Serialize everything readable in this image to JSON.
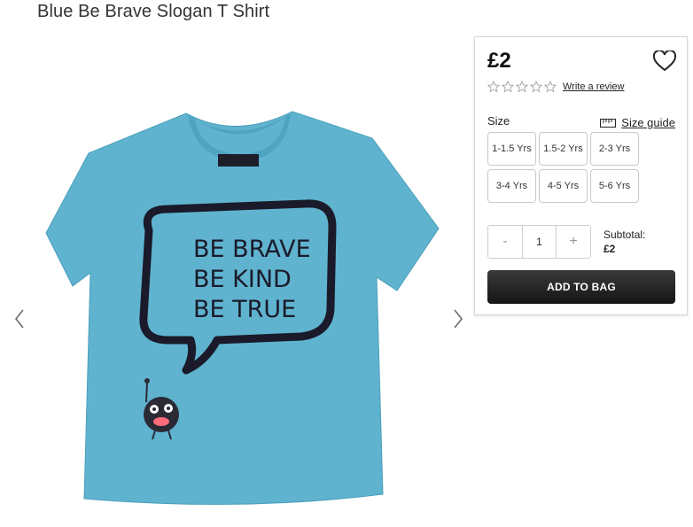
{
  "product": {
    "title": "Blue Be Brave Slogan T Shirt",
    "image_alt": "Blue t-shirt with speech bubble reading BE BRAVE BE KIND BE TRUE",
    "shirt_print": [
      "BE BRAVE",
      "BE KIND",
      "BE TRUE"
    ],
    "colors": {
      "shirt": "#5fb3cf",
      "print": "#1a1a2a"
    }
  },
  "gallery": {
    "prev_icon": "chevron-left",
    "next_icon": "chevron-right"
  },
  "panel": {
    "price": "£2",
    "wishlist_icon": "heart-outline",
    "rating_stars": 5,
    "rating_value": 0,
    "write_review": "Write a review",
    "size_label": "Size",
    "size_guide": "Size guide",
    "sizes": [
      "1-1.5 Yrs",
      "1.5-2 Yrs",
      "2-3 Yrs",
      "3-4 Yrs",
      "4-5 Yrs",
      "5-6 Yrs"
    ],
    "quantity": {
      "minus": "-",
      "value": "1",
      "plus": "+"
    },
    "subtotal_label": "Subtotal:",
    "subtotal_value": "£2",
    "add_to_bag": "ADD TO BAG"
  }
}
